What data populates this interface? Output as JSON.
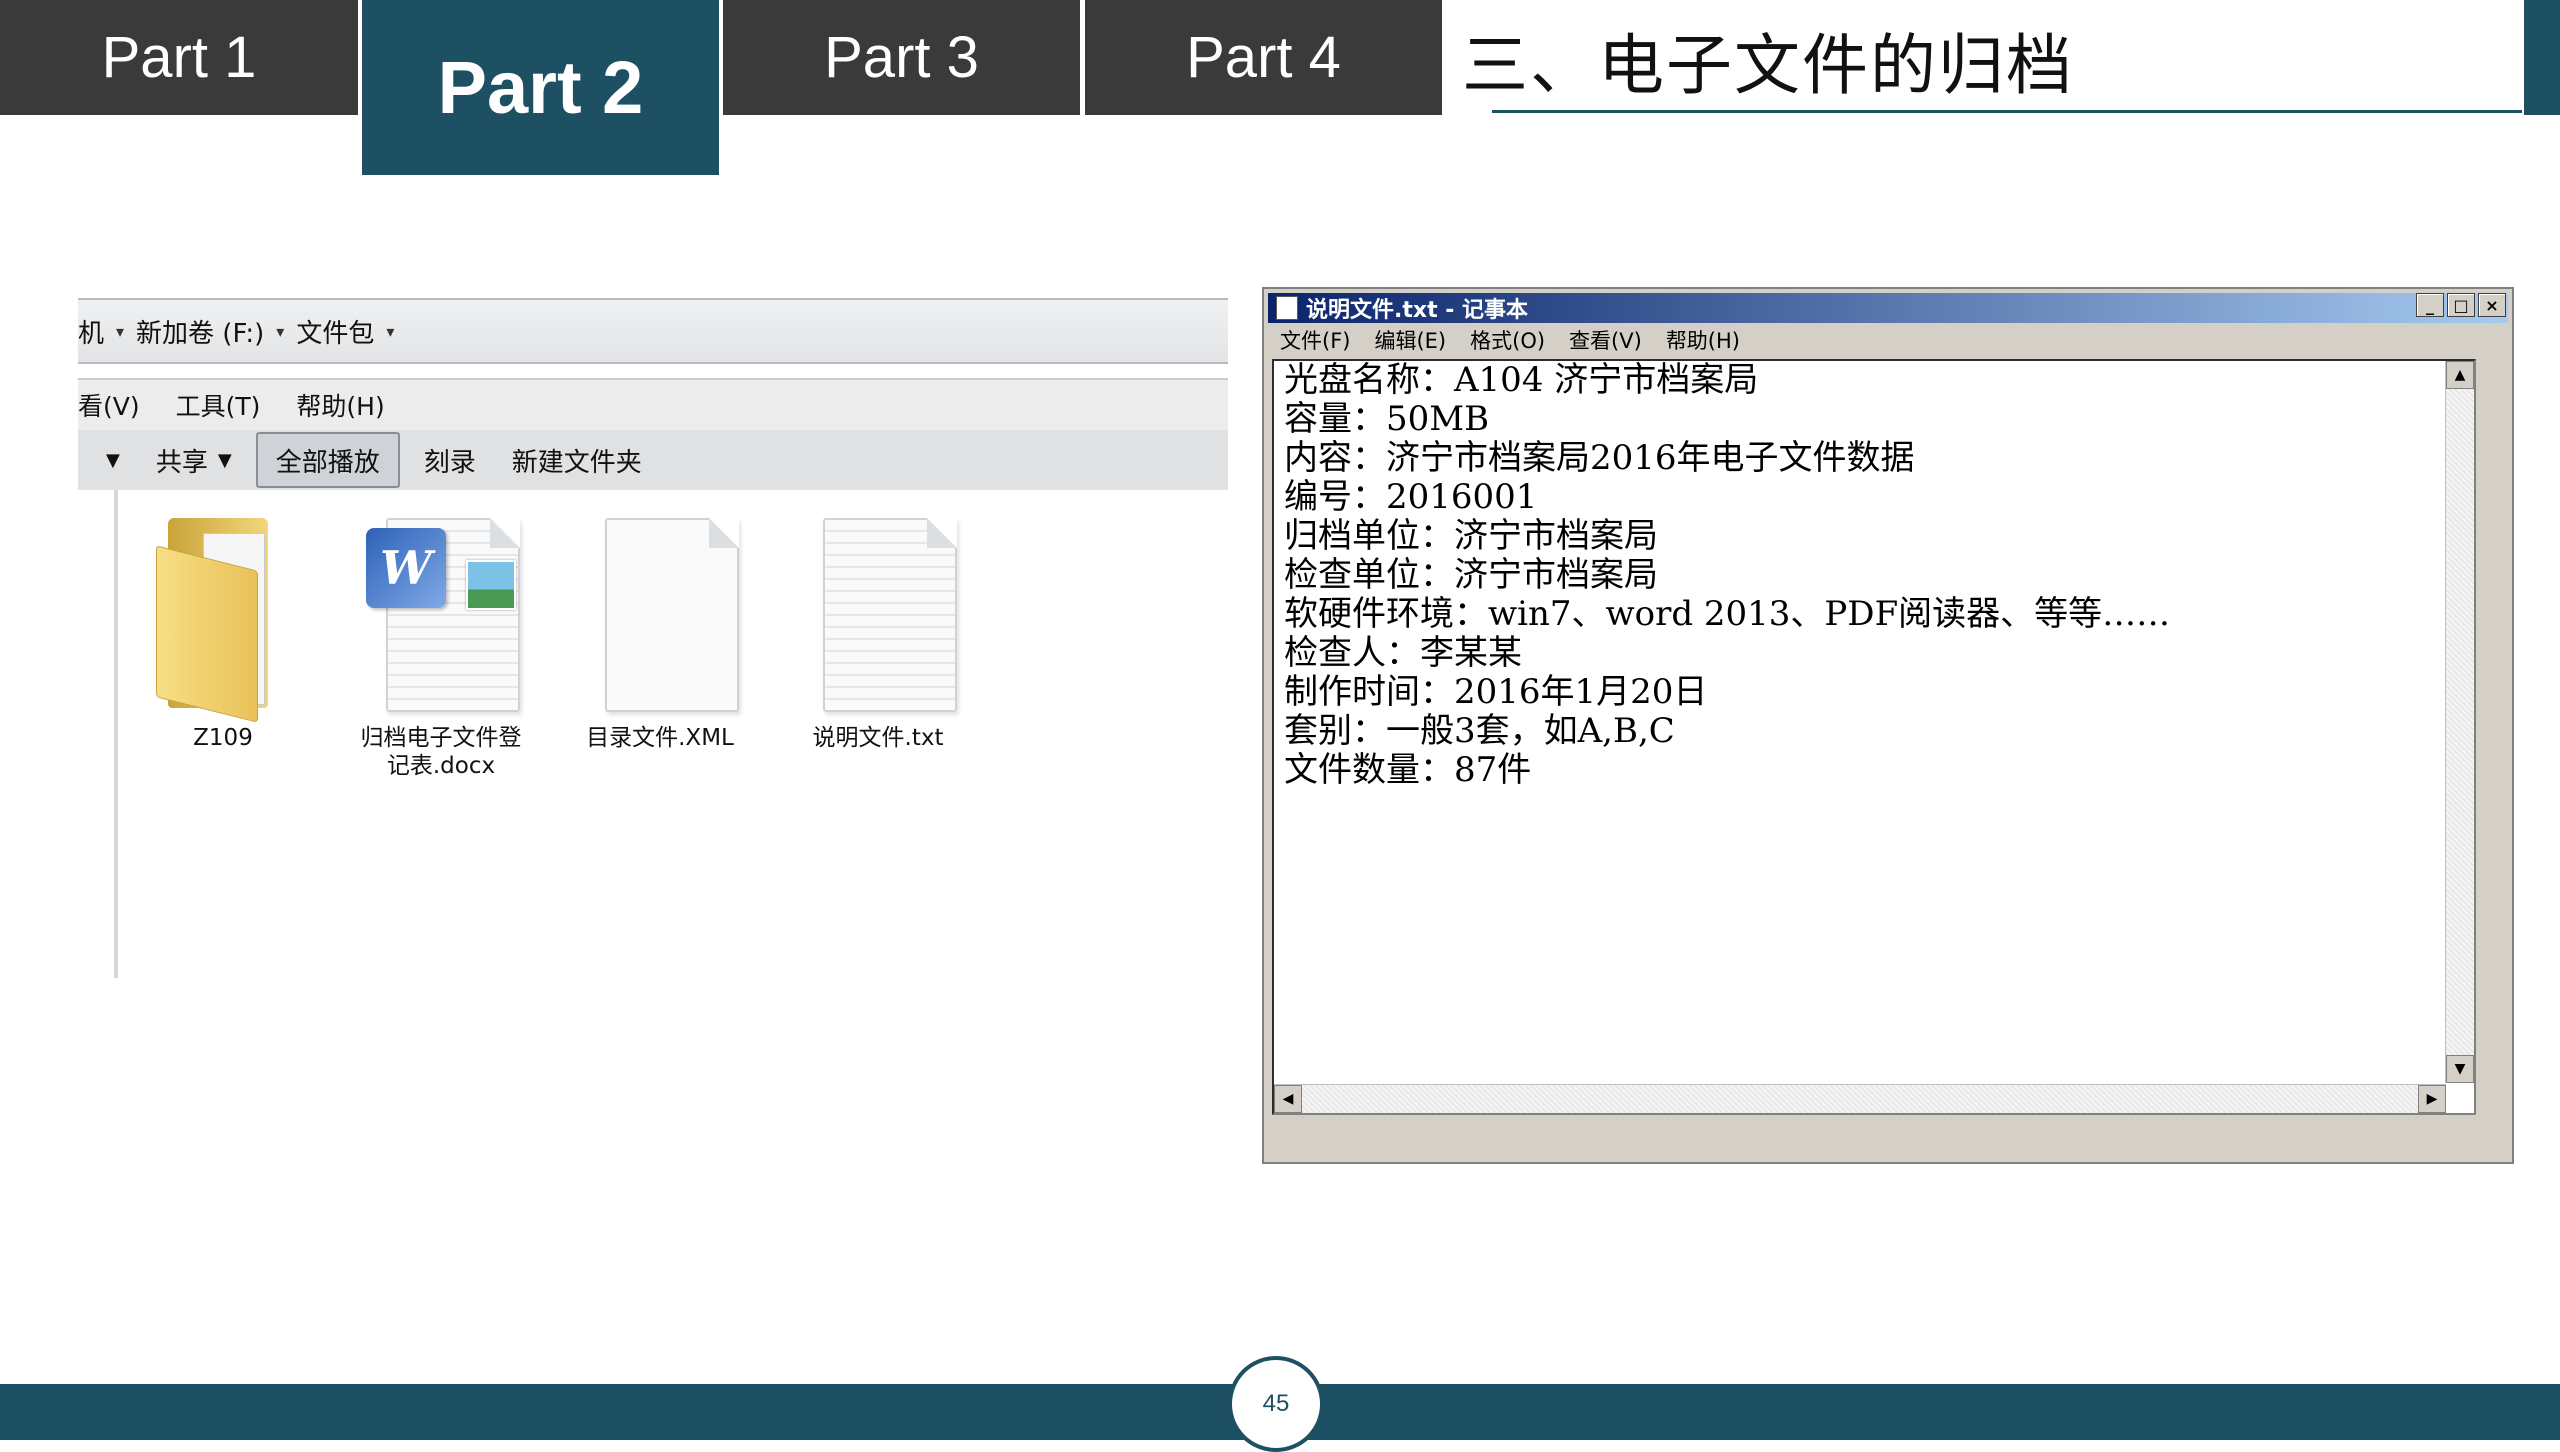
{
  "nav": {
    "tabs": [
      {
        "label": "Part 1",
        "active": false
      },
      {
        "label": "Part 2",
        "active": true
      },
      {
        "label": "Part 3",
        "active": false
      },
      {
        "label": "Part 4",
        "active": false
      }
    ]
  },
  "slide": {
    "title": "三、电子文件的归档",
    "page_number": "45"
  },
  "colors": {
    "accent": "#1e5063",
    "tab_bg": "#3a3a3a"
  },
  "explorer": {
    "breadcrumb": {
      "root_fragment": "机",
      "drive": "新加卷 (F:)",
      "folder": "文件包"
    },
    "menu": [
      "看(V)",
      "工具(T)",
      "帮助(H)"
    ],
    "toolbar": {
      "share": "共享",
      "play_all": "全部播放",
      "burn": "刻录",
      "new_folder": "新建文件夹"
    },
    "files": [
      {
        "name": "Z109",
        "icon": "folder-icon"
      },
      {
        "name": "归档电子文件登\n记表.docx",
        "icon": "word-doc-icon"
      },
      {
        "name": "目录文件.XML",
        "icon": "blank-file-icon"
      },
      {
        "name": "说明文件.txt",
        "icon": "text-file-icon"
      }
    ]
  },
  "notepad": {
    "title": "说明文件.txt - 记事本",
    "window_buttons": [
      "_",
      "□",
      "×"
    ],
    "menu": [
      "文件(F)",
      "编辑(E)",
      "格式(O)",
      "查看(V)",
      "帮助(H)"
    ],
    "lines": [
      "光盘名称：A104 济宁市档案局",
      "容量：50MB",
      "内容：济宁市档案局2016年电子文件数据",
      "编号：2016001",
      "归档单位：济宁市档案局",
      "检查单位：济宁市档案局",
      "软硬件环境：win7、word 2013、PDF阅读器、等等……",
      "检查人：李某某",
      "制作时间：2016年1月20日",
      "套别：一般3套，如A,B,C",
      "文件数量：87件"
    ]
  }
}
